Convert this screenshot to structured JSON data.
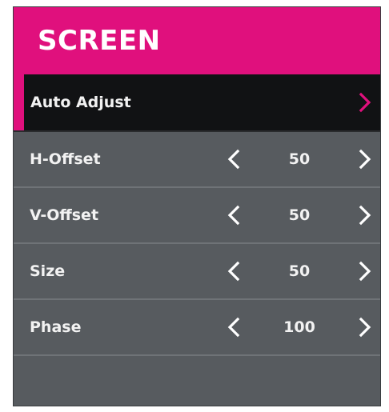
{
  "menu": {
    "title": "SCREEN",
    "accent_color": "#e0107d",
    "items": [
      {
        "label": "Auto Adjust",
        "selected": true,
        "has_value": false,
        "arrow_right_icon": "chevron-right-icon",
        "arrow_color": "#e0107d"
      },
      {
        "label": "H-Offset",
        "value": "50",
        "has_value": true,
        "arrow_left_icon": "chevron-left-icon",
        "arrow_right_icon": "chevron-right-icon"
      },
      {
        "label": "V-Offset",
        "value": "50",
        "has_value": true,
        "arrow_left_icon": "chevron-left-icon",
        "arrow_right_icon": "chevron-right-icon"
      },
      {
        "label": "Size",
        "value": "50",
        "has_value": true,
        "arrow_left_icon": "chevron-left-icon",
        "arrow_right_icon": "chevron-right-icon"
      },
      {
        "label": "Phase",
        "value": "100",
        "has_value": true,
        "arrow_left_icon": "chevron-left-icon",
        "arrow_right_icon": "chevron-right-icon"
      }
    ]
  }
}
